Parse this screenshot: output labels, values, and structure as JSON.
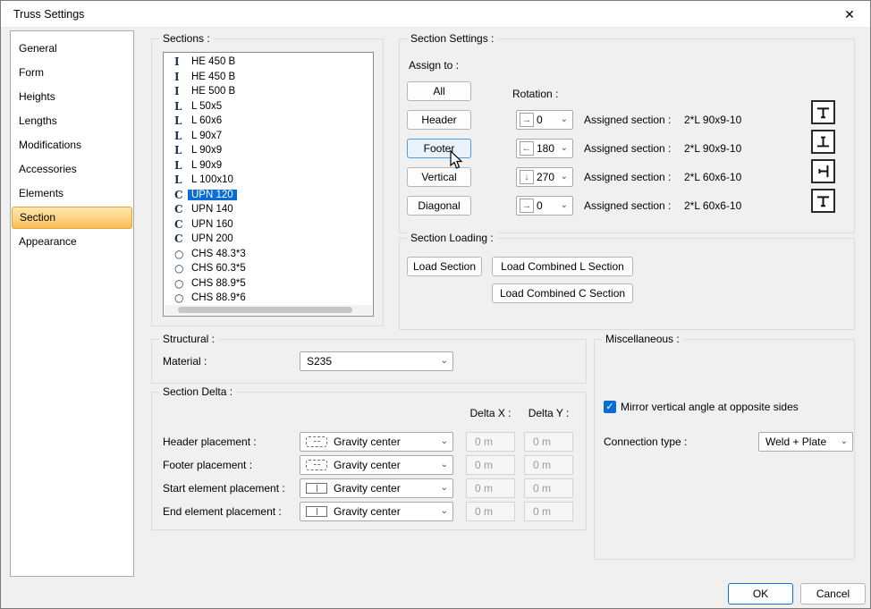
{
  "window": {
    "title": "Truss Settings",
    "close_icon": "✕"
  },
  "sidebar": {
    "items": [
      {
        "label": "General"
      },
      {
        "label": "Form"
      },
      {
        "label": "Heights"
      },
      {
        "label": "Lengths"
      },
      {
        "label": "Modifications"
      },
      {
        "label": "Accessories"
      },
      {
        "label": "Elements"
      },
      {
        "label": "Section",
        "selected": true
      },
      {
        "label": "Appearance"
      }
    ]
  },
  "sections_panel": {
    "title": "Sections :",
    "items": [
      {
        "icon": "I",
        "label": "HE 450 B"
      },
      {
        "icon": "I",
        "label": "HE 450 B"
      },
      {
        "icon": "I",
        "label": "HE 500 B"
      },
      {
        "icon": "L",
        "label": "L 50x5"
      },
      {
        "icon": "L",
        "label": "L 60x6"
      },
      {
        "icon": "L",
        "label": "L 90x7"
      },
      {
        "icon": "L",
        "label": "L 90x9"
      },
      {
        "icon": "L",
        "label": "L 90x9"
      },
      {
        "icon": "L",
        "label": "L 100x10"
      },
      {
        "icon": "C",
        "label": "UPN 120",
        "selected": true
      },
      {
        "icon": "C",
        "label": "UPN 140"
      },
      {
        "icon": "C",
        "label": "UPN 160"
      },
      {
        "icon": "C",
        "label": "UPN 200"
      },
      {
        "icon": "○",
        "label": "CHS 48.3*3"
      },
      {
        "icon": "○",
        "label": "CHS 60.3*5"
      },
      {
        "icon": "○",
        "label": "CHS 88.9*5"
      },
      {
        "icon": "○",
        "label": "CHS 88.9*6"
      }
    ]
  },
  "section_settings": {
    "title": "Section Settings :",
    "assign_to_label": "Assign to :",
    "rotation_label": "Rotation :",
    "buttons": {
      "all": "All",
      "header": "Header",
      "footer": "Footer",
      "vertical": "Vertical",
      "diagonal": "Diagonal"
    },
    "rows": [
      {
        "arrow": "→",
        "rotation": "0",
        "assigned_label": "Assigned section :",
        "assigned_value": "2*L 90x9-10",
        "preview": "tee-stem-down"
      },
      {
        "arrow": "←",
        "rotation": "180",
        "assigned_label": "Assigned section :",
        "assigned_value": "2*L 90x9-10",
        "preview": "tee-stem-up"
      },
      {
        "arrow": "↓",
        "rotation": "270",
        "assigned_label": "Assigned section :",
        "assigned_value": "2*L 60x6-10",
        "preview": "tee-stem-left"
      },
      {
        "arrow": "→",
        "rotation": "0",
        "assigned_label": "Assigned section :",
        "assigned_value": "2*L 60x6-10",
        "preview": "tee-stem-down"
      }
    ]
  },
  "section_loading": {
    "title": "Section Loading :",
    "load_section": "Load Section",
    "load_combined_l": "Load Combined L Section",
    "load_combined_c": "Load Combined C Section"
  },
  "structural": {
    "title": "Structural :",
    "material_label": "Material :",
    "material_value": "S235"
  },
  "section_delta": {
    "title": "Section Delta :",
    "delta_x_header": "Delta X :",
    "delta_y_header": "Delta Y :",
    "rows": [
      {
        "label": "Header placement :",
        "placement": "Gravity center",
        "dx": "0 m",
        "dy": "0 m",
        "icon": "dashed"
      },
      {
        "label": "Footer placement :",
        "placement": "Gravity center",
        "dx": "0 m",
        "dy": "0 m",
        "icon": "dashed"
      },
      {
        "label": "Start element placement :",
        "placement": "Gravity center",
        "dx": "0 m",
        "dy": "0 m",
        "icon": "ibeam"
      },
      {
        "label": "End element placement :",
        "placement": "Gravity center",
        "dx": "0 m",
        "dy": "0 m",
        "icon": "ibeam"
      }
    ]
  },
  "miscellaneous": {
    "title": "Miscellaneous :",
    "mirror_label": "Mirror vertical angle at opposite sides",
    "mirror_checked": true,
    "connection_label": "Connection type :",
    "connection_value": "Weld + Plate"
  },
  "footer": {
    "ok": "OK",
    "cancel": "Cancel"
  },
  "colors": {
    "selection_blue": "#0a6cd6",
    "sidebar_selection_orange": "#fbbd58",
    "arrow_red": "#bf4a3e"
  }
}
